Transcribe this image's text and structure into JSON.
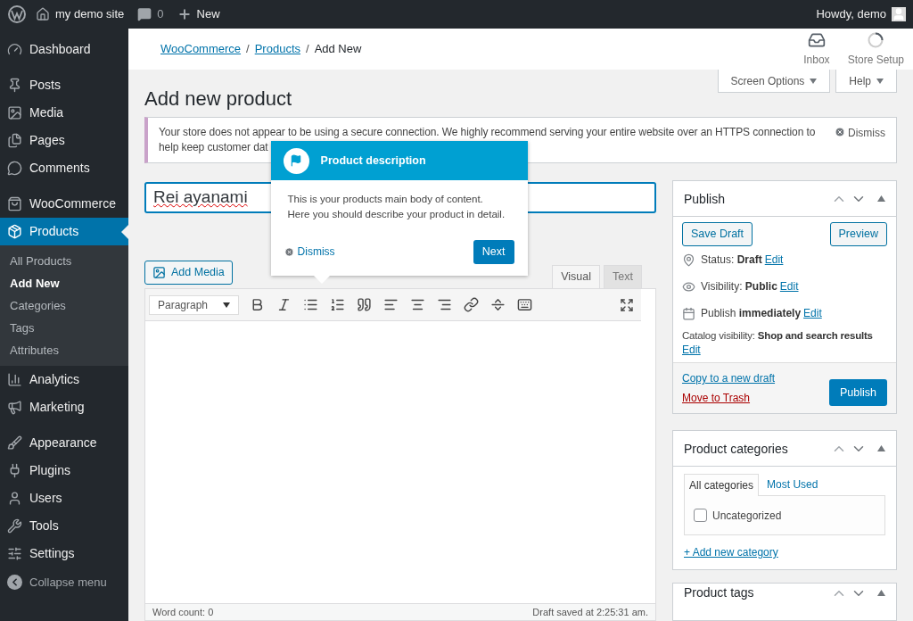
{
  "admin_bar": {
    "site": "my demo site",
    "comments": "0",
    "new": "New",
    "greeting": "Howdy, demo"
  },
  "sidebar": {
    "groups": [
      {
        "items": [
          {
            "label": "Dashboard",
            "selected": false
          }
        ]
      },
      {
        "items": [
          {
            "label": "Posts",
            "selected": false
          },
          {
            "label": "Media",
            "selected": false
          },
          {
            "label": "Pages",
            "selected": false
          },
          {
            "label": "Comments",
            "selected": false
          }
        ]
      },
      {
        "items": [
          {
            "label": "WooCommerce",
            "selected": false
          },
          {
            "label": "Products",
            "selected": true,
            "children": [
              {
                "label": "All Products",
                "selected": false
              },
              {
                "label": "Add New",
                "selected": true
              },
              {
                "label": "Categories",
                "selected": false
              },
              {
                "label": "Tags",
                "selected": false
              },
              {
                "label": "Attributes",
                "selected": false
              }
            ]
          },
          {
            "label": "Analytics",
            "selected": false
          },
          {
            "label": "Marketing",
            "selected": false
          }
        ]
      },
      {
        "items": [
          {
            "label": "Appearance",
            "selected": false
          },
          {
            "label": "Plugins",
            "selected": false
          },
          {
            "label": "Users",
            "selected": false
          },
          {
            "label": "Tools",
            "selected": false
          },
          {
            "label": "Settings",
            "selected": false
          }
        ]
      }
    ],
    "collapse": "Collapse menu"
  },
  "header": {
    "breadcrumbs": [
      {
        "label": "WooCommerce",
        "link": true
      },
      {
        "separator": "/",
        "label": "Products",
        "link": true
      },
      {
        "separator": "/",
        "label": "Add New",
        "link": false
      }
    ],
    "actions": [
      {
        "label": "Inbox"
      },
      {
        "label": "Store Setup"
      }
    ]
  },
  "screen_tabs": [
    "Screen Options",
    "Help"
  ],
  "page_title": "Add new product",
  "notice": {
    "lines": [
      "Your store does not appear to be using a secure connection. We highly recommend serving your entire website over an HTTPS connection to",
      "help keep customer dat"
    ],
    "dismiss": "Dismiss"
  },
  "title_field": {
    "value": "Rei ayanami"
  },
  "add_media": "Add Media",
  "editor_tabs": [
    {
      "label": "Visual",
      "selected": true
    },
    {
      "label": "Text",
      "selected": false
    }
  ],
  "format_select": "Paragraph",
  "word_count": "Word count: 0",
  "draft_saved": "Draft saved at 2:25:31 am.",
  "tour": {
    "title": "Product description",
    "lines": [
      "This is your products main body of content.",
      "Here you should describe your product in detail."
    ],
    "dismiss": "Dismiss",
    "next": "Next"
  },
  "publish": {
    "title": "Publish",
    "save_draft": "Save Draft",
    "preview": "Preview",
    "rows": [
      {
        "label": "Status:",
        "value": "Draft",
        "edit": "Edit"
      },
      {
        "label": "Visibility:",
        "value": "Public",
        "edit": "Edit"
      },
      {
        "label": "Publish",
        "value": "immediately",
        "edit": "Edit"
      }
    ],
    "catalog": {
      "label": "Catalog visibility:",
      "value": "Shop and search results",
      "edit": "Edit"
    },
    "copy_draft": "Copy to a new draft",
    "trash": "Move to Trash",
    "publish": "Publish"
  },
  "categories": {
    "title": "Product categories",
    "tabs": [
      {
        "label": "All categories",
        "selected": true
      },
      {
        "label": "Most Used",
        "selected": false
      }
    ],
    "items": [
      {
        "label": "Uncategorized",
        "checked": false
      }
    ],
    "add": "+ Add new category"
  },
  "tags": {
    "title": "Product tags"
  }
}
